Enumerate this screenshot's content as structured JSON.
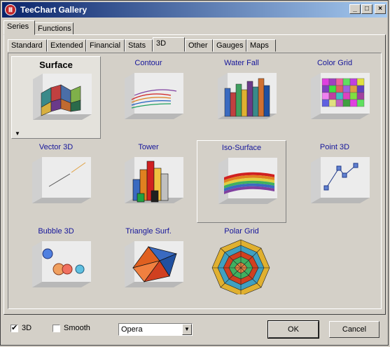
{
  "window": {
    "title": "TeeChart Gallery",
    "icon": "teechart-app-icon",
    "controls": {
      "minimize": "_",
      "maximize": "□",
      "close": "×"
    }
  },
  "main_tabs": [
    "Series",
    "Functions"
  ],
  "sub_tabs": [
    "Standard",
    "Extended",
    "Financial",
    "Stats",
    "3D",
    "Other",
    "Gauges",
    "Maps"
  ],
  "active_sub_tab": "3D",
  "gallery": [
    {
      "label": "Surface",
      "selected": true
    },
    {
      "label": "Contour"
    },
    {
      "label": "Water Fall"
    },
    {
      "label": "Color Grid"
    },
    {
      "label": "Vector 3D"
    },
    {
      "label": "Tower"
    },
    {
      "label": "Iso-Surface",
      "hover": true
    },
    {
      "label": "Point 3D"
    },
    {
      "label": "Bubble 3D"
    },
    {
      "label": "Triangle Surf."
    },
    {
      "label": "Polar Grid"
    }
  ],
  "bottom": {
    "check_3d_label": "3D",
    "check_3d_checked": true,
    "check_smooth_label": "Smooth",
    "check_smooth_checked": false,
    "theme_value": "Opera",
    "ok_label": "OK",
    "cancel_label": "Cancel"
  }
}
